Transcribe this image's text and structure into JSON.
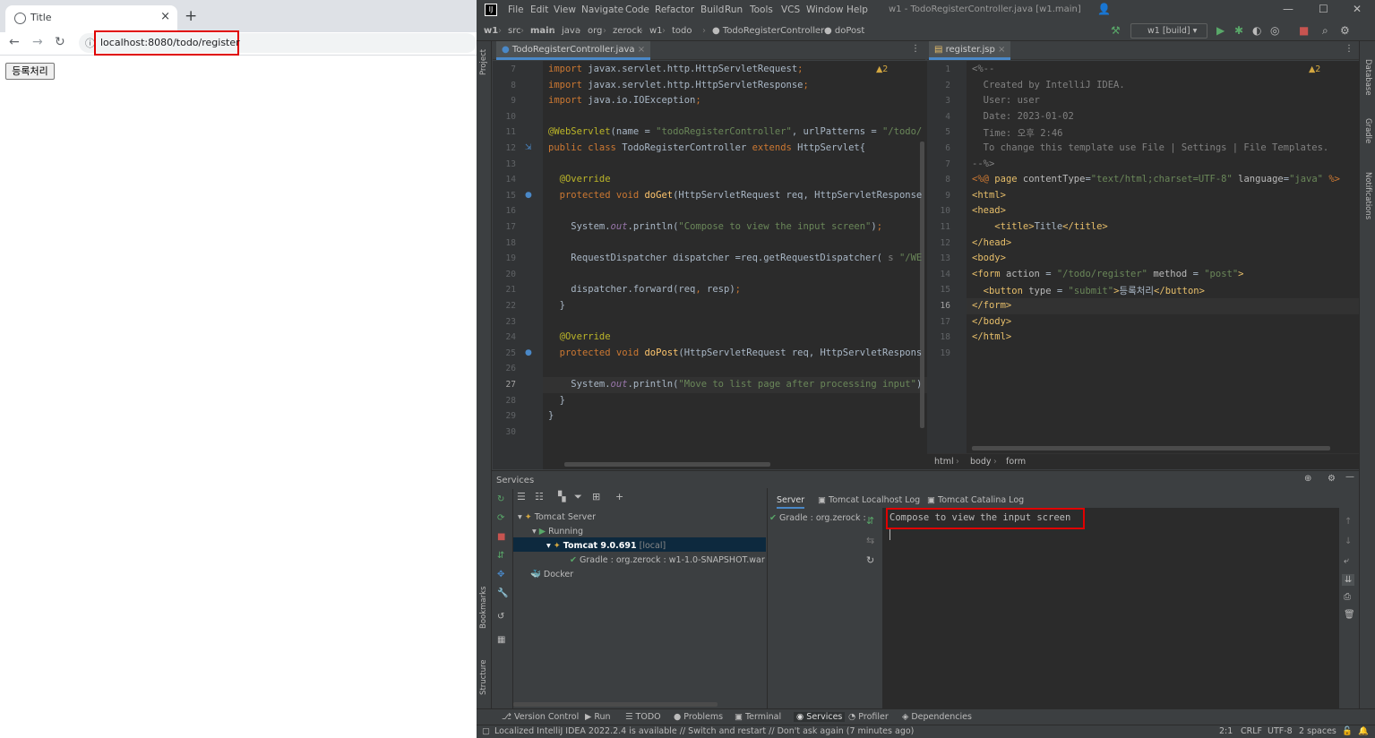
{
  "browser": {
    "tab_title": "Title",
    "tab_close": "×",
    "new_tab": "+",
    "url": "localhost:8080/todo/register",
    "page_button": "등록처리"
  },
  "ide": {
    "menu": [
      "File",
      "Edit",
      "View",
      "Navigate",
      "Code",
      "Refactor",
      "Build",
      "Run",
      "Tools",
      "VCS",
      "Window",
      "Help"
    ],
    "window_title": "w1 - TodoRegisterController.java [w1.main]",
    "breadcrumbs": [
      "w1",
      "src",
      "main",
      "java",
      "org",
      "zerock",
      "w1",
      "todo",
      "TodoRegisterController",
      "doPost"
    ],
    "run_config": "w1 [build]",
    "left_stripe": [
      "Project",
      "Bookmarks",
      "Structure"
    ],
    "right_stripe": [
      "Database",
      "Gradle",
      "Notifications"
    ],
    "editor_left": {
      "tab": "TodoRegisterController.java",
      "warnings": "▲2",
      "lines": [
        {
          "n": "7",
          "html": "<span class=\"k\">import </span>javax.servlet.http.HttpServletRequest<span class=\"k\">;</span>"
        },
        {
          "n": "8",
          "html": "<span class=\"k\">import </span>javax.servlet.http.HttpServletResponse<span class=\"k\">;</span>"
        },
        {
          "n": "9",
          "html": "<span class=\"k\">import </span>java.io.IOException<span class=\"k\">;</span>"
        },
        {
          "n": "10",
          "html": ""
        },
        {
          "n": "11",
          "html": "<span class=\"a\">@WebServlet</span>(name = <span class=\"s\">\"todoRegisterController\"</span>, urlPatterns = <span class=\"s\">\"/todo/</span>"
        },
        {
          "n": "12",
          "html": "<span class=\"k\">public class </span>TodoRegisterController <span class=\"k\">extends </span>HttpServlet{"
        },
        {
          "n": "13",
          "html": ""
        },
        {
          "n": "14",
          "html": "  <span class=\"a\">@Override</span>"
        },
        {
          "n": "15",
          "html": "  <span class=\"k\">protected void </span><span class=\"m\">doGet</span>(HttpServletRequest req, HttpServletResponse"
        },
        {
          "n": "16",
          "html": ""
        },
        {
          "n": "17",
          "html": "    System.<span class=\"i\">out</span>.println(<span class=\"s\">\"Compose to view the input screen\"</span>)<span class=\"k\">;</span>"
        },
        {
          "n": "18",
          "html": ""
        },
        {
          "n": "19",
          "html": "    RequestDispatcher dispatcher =req.getRequestDispatcher( <span class=\"c\">s</span> <span class=\"s\">\"/WE</span>"
        },
        {
          "n": "20",
          "html": ""
        },
        {
          "n": "21",
          "html": "    dispatcher.forward(req<span class=\"k\">, </span>resp)<span class=\"k\">;</span>"
        },
        {
          "n": "22",
          "html": "  }"
        },
        {
          "n": "23",
          "html": ""
        },
        {
          "n": "24",
          "html": "  <span class=\"a\">@Override</span>"
        },
        {
          "n": "25",
          "html": "  <span class=\"k\">protected void </span><span class=\"m\">doPost</span>(HttpServletRequest req, HttpServletRespons"
        },
        {
          "n": "26",
          "html": ""
        },
        {
          "n": "27",
          "html": "    System.<span class=\"i\">out</span>.println(<span class=\"s\">\"Move to list page after processing input\"</span>)"
        },
        {
          "n": "28",
          "html": "  }"
        },
        {
          "n": "29",
          "html": "}"
        },
        {
          "n": "30",
          "html": ""
        }
      ]
    },
    "editor_right": {
      "tab": "register.jsp",
      "warnings": "▲2",
      "lines": [
        {
          "n": "1",
          "html": "<span class=\"c\">&lt;%--</span>"
        },
        {
          "n": "2",
          "html": "<span class=\"c\">  Created by IntelliJ IDEA.</span>"
        },
        {
          "n": "3",
          "html": "<span class=\"c\">  User: user</span>"
        },
        {
          "n": "4",
          "html": "<span class=\"c\">  Date: 2023-01-02</span>"
        },
        {
          "n": "5",
          "html": "<span class=\"c\">  Time: 오후 2:46</span>"
        },
        {
          "n": "6",
          "html": "<span class=\"c\">  To change this template use File | Settings | File Templates.</span>"
        },
        {
          "n": "7",
          "html": "<span class=\"c\">--%&gt;</span>"
        },
        {
          "n": "8",
          "html": "<span class=\"k\">&lt;%@ </span><span class=\"t\">page </span><span class=\"at\">contentType</span>=<span class=\"s\">\"text/html;charset=UTF-8\"</span> <span class=\"at\">language</span>=<span class=\"s\">\"java\"</span> <span class=\"k\">%&gt;</span>"
        },
        {
          "n": "9",
          "html": "<span class=\"t\">&lt;html&gt;</span>"
        },
        {
          "n": "10",
          "html": "<span class=\"t\">&lt;head&gt;</span>"
        },
        {
          "n": "11",
          "html": "    <span class=\"t\">&lt;title&gt;</span>Title<span class=\"t\">&lt;/title&gt;</span>"
        },
        {
          "n": "12",
          "html": "<span class=\"t\">&lt;/head&gt;</span>"
        },
        {
          "n": "13",
          "html": "<span class=\"t\">&lt;body&gt;</span>"
        },
        {
          "n": "14",
          "html": "<span class=\"t\">&lt;form </span><span class=\"at\">action</span> = <span class=\"s\">\"/todo/register\"</span> <span class=\"at\">method</span> = <span class=\"s\">\"post\"</span><span class=\"t\">&gt;</span>"
        },
        {
          "n": "15",
          "html": "  <span class=\"t\">&lt;button </span><span class=\"at\">type</span> = <span class=\"s\">\"submit\"</span><span class=\"t\">&gt;</span>등록처리<span class=\"t\">&lt;/button&gt;</span>"
        },
        {
          "n": "16",
          "html": "<span class=\"t\">&lt;/form&gt;</span>"
        },
        {
          "n": "17",
          "html": "<span class=\"t\">&lt;/body&gt;</span>"
        },
        {
          "n": "18",
          "html": "<span class=\"t\">&lt;/html&gt;</span>"
        },
        {
          "n": "19",
          "html": ""
        }
      ],
      "breadcrumb": [
        "html",
        "body",
        "form"
      ]
    },
    "services": {
      "title": "Services",
      "tree": [
        "Tomcat Server",
        "Running",
        "Tomcat 9.0.691",
        "[local]",
        "Gradle : org.zerock : w1-1.0-SNAPSHOT.war",
        "Docker"
      ],
      "detail_tabs": [
        "Server",
        "Tomcat Localhost Log",
        "Tomcat Catalina Log"
      ],
      "deploy_item": "Gradle : org.zerock :",
      "console_output": "Compose to view the input screen"
    },
    "bottom_tabs": [
      "Version Control",
      "Run",
      "TODO",
      "Problems",
      "Terminal",
      "Services",
      "Profiler",
      "Dependencies"
    ],
    "status": {
      "message": "Localized IntelliJ IDEA 2022.2.4 is available // Switch and restart // Don't ask again (7 minutes ago)",
      "position": "2:1",
      "line_sep": "CRLF",
      "encoding": "UTF-8",
      "indent": "2 spaces"
    }
  }
}
